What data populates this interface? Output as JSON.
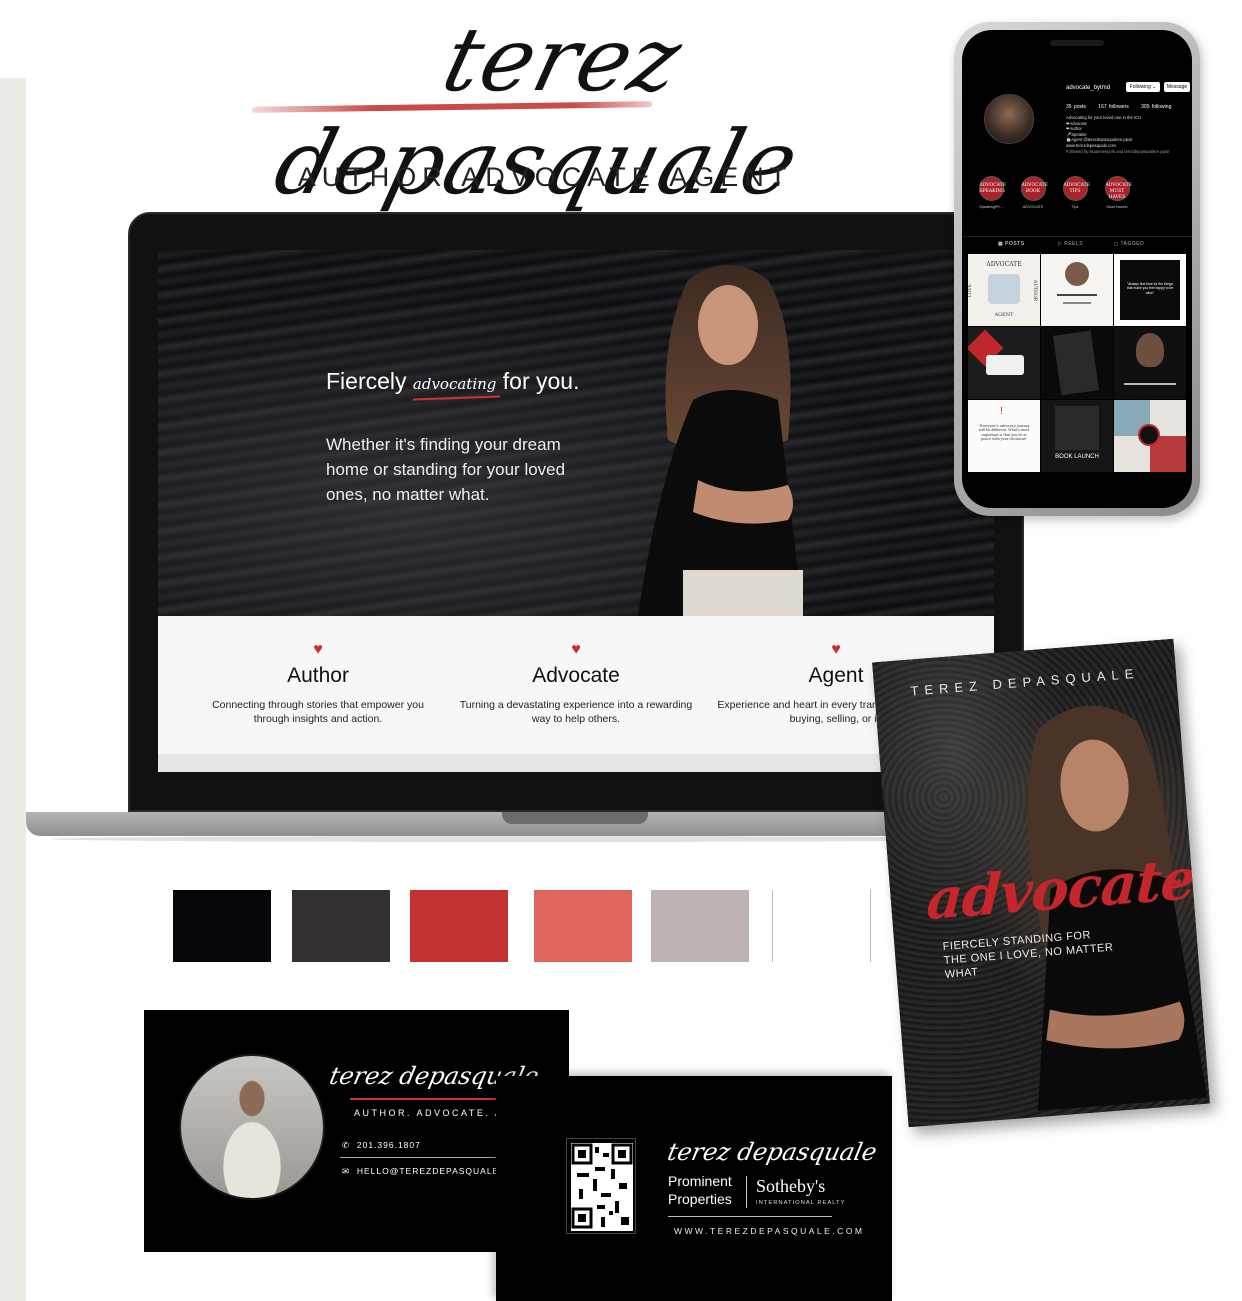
{
  "logo": {
    "script": "terez depasquale",
    "tagline": "AUTHOR.ADVOCATE.AGENT",
    "accent_color": "#c94a4a"
  },
  "website": {
    "hero": {
      "heading_before": "Fiercely",
      "heading_accent": "advocating",
      "heading_after": "for you.",
      "body": "Whether it's finding your dream home or standing for your loved ones, no matter what."
    },
    "features": [
      {
        "icon": "heart-icon",
        "title": "Author",
        "description": "Connecting through stories that empower you through insights and action."
      },
      {
        "icon": "heart-icon",
        "title": "Advocate",
        "description": "Turning a devastating experience into a rewarding way to help others."
      },
      {
        "icon": "heart-icon",
        "title": "Agent",
        "description": "Experience and heart in every trans whether you're buying, selling, or in"
      }
    ]
  },
  "instagram": {
    "username": "advocate_bytmd",
    "following_button": "Following ⌄",
    "message_button": "Message",
    "stats": {
      "posts": "35 posts",
      "followers": "167 followers",
      "following": "305 following"
    },
    "bio": [
      "Advocating for your loved one in the ICU",
      "❤Advocate",
      "❤Author",
      "🎤Speaker",
      "🏠Agent @terezdepasqualere.ppoir",
      "www.terezdepasquale.com",
      "Followed by lisaannesyork and terezdepasqualere.ppoir"
    ],
    "highlights": [
      {
        "circle": "ADVOCATE SPEAKING",
        "label": "Speaking/Pr..."
      },
      {
        "circle": "ADVOCATE BOOK",
        "label": "ADVOCATE"
      },
      {
        "circle": "ADVOCATE TIPS",
        "label": "Tips"
      },
      {
        "circle": "ADVOCATE MUST HAVES",
        "label": "Must Haves!"
      }
    ],
    "tabs": [
      "POSTS",
      "REELS",
      "TAGGED"
    ],
    "post_texts": {
      "p1_top": "ADVOCATE",
      "p1_left": "LOVE",
      "p1_right": "AUTHOR",
      "p1_bottom": "AGENT",
      "p6_text": "\"Always find time for the things that make you feel happy to be alive\"",
      "p7_text": "\"Everyone's advocacy journey will be different. What's most important is that you're at peace with your decisions\"",
      "p8_text": "BOOK LAUNCH"
    }
  },
  "palette": [
    "#000000",
    "#342f31",
    "#c23333",
    "#e0655f",
    "#bdb3b2",
    "#ffffff"
  ],
  "book": {
    "author": "TEREZ DEPASQUALE",
    "title": "advocate",
    "subtitle": "FIERCELY STANDING FOR THE ONE I LOVE, NO MATTER WHAT"
  },
  "business_card_front": {
    "script": "terez depasquale",
    "tagline": "AUTHOR. ADVOCATE. AGENT",
    "phone": "201.396.1807",
    "email": "HELLO@TEREZDEPASQUALE.COM"
  },
  "business_card_back": {
    "script": "terez depasquale",
    "brokerage_line1": "Prominent",
    "brokerage_line2": "Properties",
    "sothebys": "Sotheby's",
    "sothebys_sub": "INTERNATIONAL REALTY",
    "website": "WWW.TEREZDEPASQUALE.COM"
  }
}
